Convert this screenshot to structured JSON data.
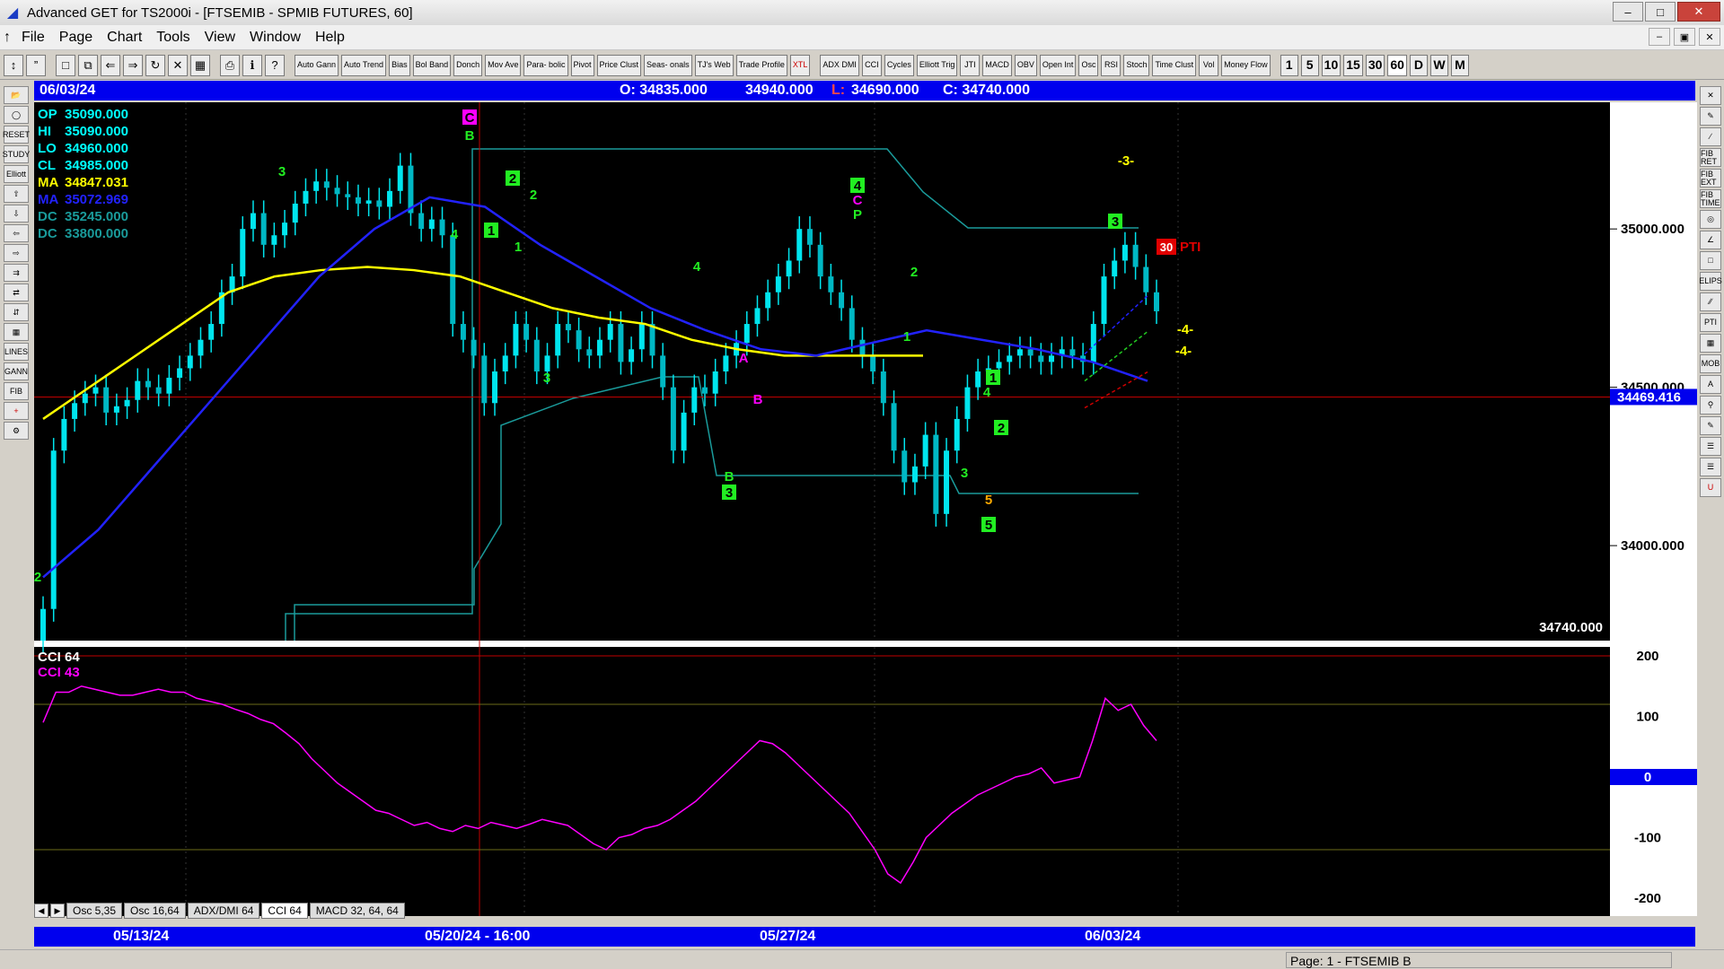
{
  "window": {
    "title": "Advanced GET for TS2000i - [FTSEMIB - SPMIB FUTURES, 60]",
    "min": "–",
    "max": "□",
    "close": "✕"
  },
  "menu": {
    "items": [
      "File",
      "Page",
      "Chart",
      "Tools",
      "View",
      "Window",
      "Help"
    ],
    "mdi": [
      "–",
      "▣",
      "✕"
    ]
  },
  "toolbar": {
    "buttons": [
      "Auto Gann",
      "Auto Trend",
      "Bias",
      "Bol Band",
      "Donch",
      "Mov Ave",
      "Para- bolic",
      "Pivot",
      "Price Clust",
      "Seas- onals",
      "TJ's Web",
      "Trade Profile",
      "XTL",
      "ADX DMI",
      "CCI",
      "Cycles",
      "Elliott Trig",
      "JTI",
      "MACD",
      "OBV",
      "Open Int",
      "Osc",
      "RSI",
      "Stoch",
      "Time Clust",
      "Vol",
      "Money Flow"
    ],
    "intervals": [
      "1",
      "5",
      "10",
      "15",
      "30",
      "60",
      "D",
      "W",
      "M"
    ]
  },
  "info": {
    "date": "06/03/24",
    "open": "O: 34835.000",
    "high": "34940.000",
    "low_label": "L:",
    "low": "34690.000",
    "close": "C: 34740.000"
  },
  "legend": [
    {
      "label": "OP",
      "value": "35090.000",
      "color": "#00ffff"
    },
    {
      "label": "HI",
      "value": "35090.000",
      "color": "#00ffff"
    },
    {
      "label": "LO",
      "value": "34960.000",
      "color": "#00ffff"
    },
    {
      "label": "CL",
      "value": "34985.000",
      "color": "#00ffff"
    },
    {
      "label": "MA",
      "value": "34847.031",
      "color": "#ffff00"
    },
    {
      "label": "MA",
      "value": "35072.969",
      "color": "#2222ff"
    },
    {
      "label": "DC",
      "value": "35245.000",
      "color": "#1a9b9b"
    },
    {
      "label": "DC",
      "value": "33800.000",
      "color": "#1a9b9b"
    }
  ],
  "price_axis": {
    "ticks": [
      "35000.000",
      "34500.000",
      "34000.000"
    ],
    "current_price": "34469.416",
    "last_close": "34740.000"
  },
  "pti": {
    "value": "30",
    "label": "PTI"
  },
  "wave_labels": [
    {
      "t": "C",
      "color": "#ff00ff",
      "box": true
    },
    {
      "t": "B",
      "color": "#22ee22",
      "box": false
    },
    {
      "t": "3",
      "color": "#22ee22",
      "box": false
    },
    {
      "t": "2",
      "color": "#22ee22",
      "box": true
    },
    {
      "t": "2",
      "color": "#22ee22",
      "box": false
    },
    {
      "t": "4",
      "color": "#22ee22",
      "box": false
    },
    {
      "t": "1",
      "color": "#22ee22",
      "box": true
    },
    {
      "t": "1",
      "color": "#22ee22",
      "box": false
    },
    {
      "t": "3",
      "color": "#22ee22",
      "box": false
    },
    {
      "t": "4",
      "color": "#22ee22",
      "box": false
    },
    {
      "t": "A",
      "color": "#ff00ff",
      "box": false
    },
    {
      "t": "B",
      "color": "#ff00ff",
      "box": false
    },
    {
      "t": "B",
      "color": "#22ee22",
      "box": false
    },
    {
      "t": "3",
      "color": "#22ee22",
      "box": true
    },
    {
      "t": "4",
      "color": "#22ee22",
      "box": true
    },
    {
      "t": "C",
      "color": "#ff00ff",
      "box": false
    },
    {
      "t": "P",
      "color": "#22ee22",
      "box": false
    },
    {
      "t": "2",
      "color": "#22ee22",
      "box": false
    },
    {
      "t": "1",
      "color": "#22ee22",
      "box": false
    },
    {
      "t": "1",
      "color": "#22ee22",
      "box": true
    },
    {
      "t": "4",
      "color": "#22ee22",
      "box": false
    },
    {
      "t": "2",
      "color": "#22ee22",
      "box": true
    },
    {
      "t": "3",
      "color": "#22ee22",
      "box": false
    },
    {
      "t": "5",
      "color": "#ffaa00",
      "box": false
    },
    {
      "t": "5",
      "color": "#22ee22",
      "box": true
    },
    {
      "t": "3",
      "color": "#22ee22",
      "box": true
    },
    {
      "t": "-3-",
      "color": "#ffff00",
      "box": false
    },
    {
      "t": "-4-",
      "color": "#ffff00",
      "box": false
    },
    {
      "t": "-4-",
      "color": "#ffff00",
      "box": false
    },
    {
      "t": "2",
      "color": "#22ee22",
      "box": false
    }
  ],
  "cci": {
    "labels": [
      {
        "t": "CCI 64",
        "color": "#ffffff"
      },
      {
        "t": "CCI  43",
        "color": "#ff00ff"
      }
    ],
    "axis": [
      "200",
      "100",
      "0",
      "-100",
      "-200"
    ],
    "zero_label": "0",
    "values": [
      90,
      140,
      140,
      150,
      145,
      140,
      135,
      135,
      140,
      145,
      140,
      140,
      130,
      125,
      120,
      112,
      105,
      95,
      88,
      72,
      55,
      30,
      10,
      -10,
      -25,
      -40,
      -55,
      -60,
      -70,
      -80,
      -75,
      -85,
      -90,
      -80,
      -85,
      -75,
      -80,
      -85,
      -78,
      -70,
      -75,
      -80,
      -95,
      -110,
      -120,
      -100,
      -95,
      -85,
      -80,
      -70,
      -55,
      -40,
      -20,
      0,
      20,
      40,
      60,
      55,
      40,
      20,
      0,
      -20,
      -40,
      -60,
      -90,
      -120,
      -160,
      -175,
      -140,
      -100,
      -80,
      -60,
      -45,
      -30,
      -20,
      -10,
      0,
      5,
      15,
      -10,
      -5,
      0,
      60,
      130,
      110,
      120,
      85,
      60
    ]
  },
  "tabs": [
    "Osc 5,35",
    "Osc 16,64",
    "ADX/DMI 64",
    "CCI 64",
    "MACD 32, 64, 64"
  ],
  "dates": {
    "d1": "05/13/24",
    "d2": "05/20/24 - 16:00",
    "d3": "05/27/24",
    "d4": "06/03/24"
  },
  "status": {
    "page": "Page: 1 - FTSEMIB B"
  },
  "chart_data": {
    "type": "candlestick",
    "price_range": [
      33700,
      35400
    ],
    "closes": [
      33800,
      34300,
      34400,
      34450,
      34480,
      34500,
      34420,
      34440,
      34460,
      34520,
      34500,
      34480,
      34530,
      34560,
      34600,
      34650,
      34700,
      34800,
      34850,
      35000,
      35050,
      34950,
      34980,
      35020,
      35080,
      35120,
      35150,
      35130,
      35110,
      35100,
      35080,
      35090,
      35070,
      35120,
      35200,
      35050,
      35000,
      35030,
      34980,
      34700,
      34650,
      34600,
      34450,
      34550,
      34600,
      34700,
      34650,
      34550,
      34600,
      34700,
      34680,
      34620,
      34600,
      34650,
      34700,
      34580,
      34620,
      34700,
      34600,
      34500,
      34300,
      34420,
      34500,
      34480,
      34550,
      34600,
      34640,
      34700,
      34750,
      34800,
      34850,
      34900,
      35000,
      34950,
      34850,
      34800,
      34750,
      34650,
      34600,
      34550,
      34450,
      34300,
      34200,
      34250,
      34350,
      34100,
      34300,
      34400,
      34500,
      34550,
      34560,
      34580,
      34600,
      34620,
      34600,
      34580,
      34600,
      34620,
      34600,
      34580,
      34700,
      34850,
      34900,
      34950,
      34880,
      34800,
      34740
    ],
    "ma_slow": [
      34400,
      34500,
      34600,
      34700,
      34800,
      34850,
      34870,
      34880,
      34870,
      34850,
      34800,
      34750,
      34720,
      34700,
      34650,
      34620,
      34600,
      34600,
      34600,
      34600
    ],
    "ma_fast": [
      33900,
      34050,
      34250,
      34450,
      34650,
      34850,
      35000,
      35100,
      35070,
      34950,
      34850,
      34750,
      34680,
      34620,
      34600,
      34640,
      34680,
      34650,
      34620,
      34580,
      34520
    ]
  }
}
